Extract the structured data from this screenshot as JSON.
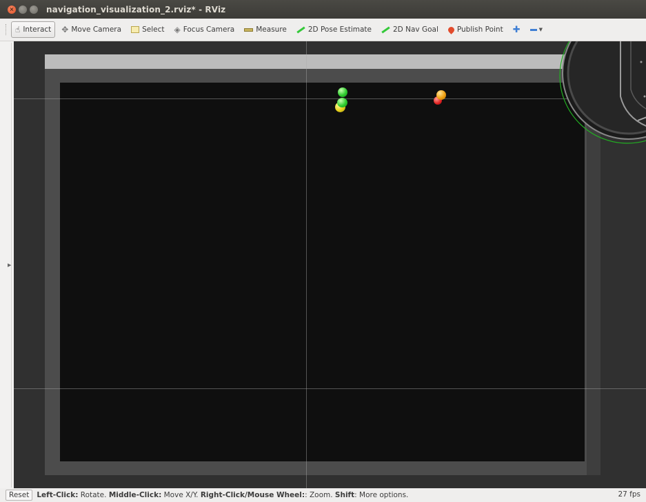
{
  "window": {
    "title": "navigation_visualization_2.rviz* - RViz"
  },
  "toolbar": {
    "tools": [
      {
        "label": "Interact",
        "icon": "hand-icon",
        "active": true
      },
      {
        "label": "Move Camera",
        "icon": "move-camera-icon"
      },
      {
        "label": "Select",
        "icon": "select-icon"
      },
      {
        "label": "Focus Camera",
        "icon": "focus-camera-icon"
      },
      {
        "label": "Measure",
        "icon": "measure-icon"
      },
      {
        "label": "2D Pose Estimate",
        "icon": "green-arrow-icon"
      },
      {
        "label": "2D Nav Goal",
        "icon": "green-arrow-icon"
      },
      {
        "label": "Publish Point",
        "icon": "red-pin-icon"
      }
    ]
  },
  "statusbar": {
    "reset_label": "Reset",
    "hint": [
      {
        "b": "Left-Click:",
        "t": " Rotate. "
      },
      {
        "b": "Middle-Click:",
        "t": " Move X/Y. "
      },
      {
        "b": "Right-Click/Mouse Wheel:",
        "t": ": Zoom. "
      },
      {
        "b": "Shift",
        "t": ": More options."
      }
    ],
    "fps": "27 fps"
  },
  "colors": {
    "background": "#303030",
    "map_border": "#4c4c4c",
    "map_interior": "#0f0f0f",
    "waypoint_green": "#2ecc2e",
    "waypoint_yellow": "#e6d21c",
    "waypoint_orange": "#f0a010",
    "waypoint_red": "#e02020"
  }
}
